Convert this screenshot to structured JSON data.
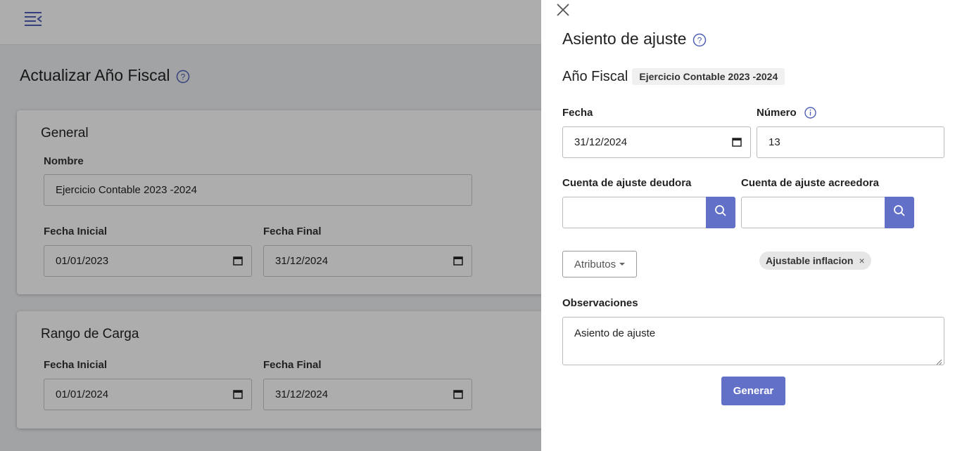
{
  "background": {
    "page_title": "Actualizar Año Fiscal",
    "general": {
      "title": "General",
      "nombre_label": "Nombre",
      "nombre_value": "Ejercicio Contable 2023 -2024",
      "fecha_inicial_label": "Fecha Inicial",
      "fecha_inicial_value": "01/01/2023",
      "fecha_final_label": "Fecha Final",
      "fecha_final_value": "31/12/2024"
    },
    "rango": {
      "title": "Rango de Carga",
      "fecha_inicial_label": "Fecha Inicial",
      "fecha_inicial_value": "01/01/2024",
      "fecha_final_label": "Fecha Final",
      "fecha_final_value": "31/12/2024"
    }
  },
  "panel": {
    "title": "Asiento de ajuste",
    "fiscal_year_label": "Año Fiscal",
    "fiscal_year_value": "Ejercicio Contable 2023 -2024",
    "fecha_label": "Fecha",
    "fecha_value": "31/12/2024",
    "numero_label": "Número",
    "numero_value": "13",
    "deudora_label": "Cuenta de ajuste deudora",
    "deudora_value": "",
    "acreedora_label": "Cuenta de ajuste acreedora",
    "acreedora_value": "",
    "attributes_button": "Atributos",
    "chip_label": "Ajustable inflacion",
    "chip_remove": "×",
    "observaciones_label": "Observaciones",
    "observaciones_value": "Asiento de ajuste",
    "generate_button": "Generar"
  },
  "colors": {
    "accent": "#6270c8",
    "icon_blue": "#4f5fb8"
  },
  "icons": [
    "menu-collapse-icon",
    "help-icon",
    "calendar-icon",
    "close-icon",
    "info-icon",
    "search-icon",
    "caret-down-icon",
    "remove-chip-icon",
    "resize-handle-icon"
  ]
}
